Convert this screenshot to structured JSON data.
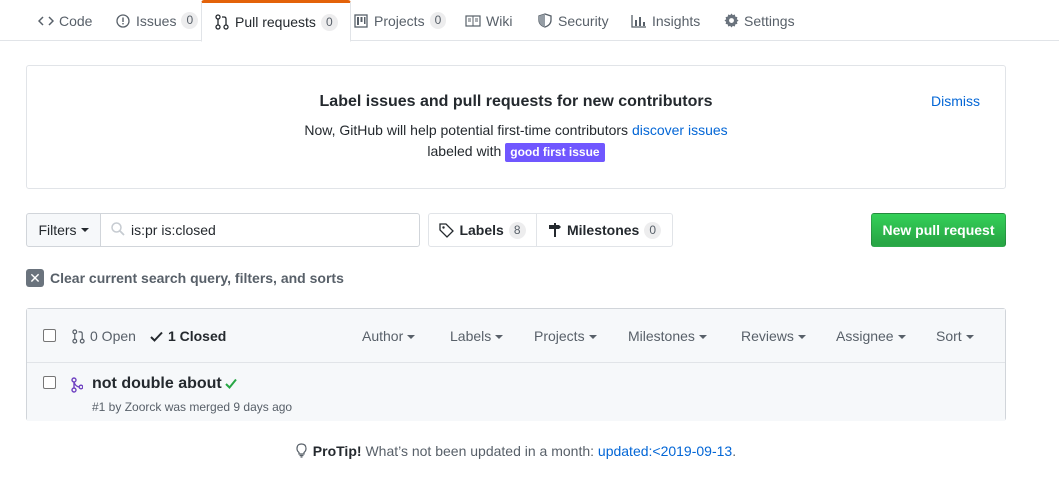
{
  "tabs": {
    "code": {
      "label": "Code"
    },
    "issues": {
      "label": "Issues",
      "count": "0"
    },
    "pulls": {
      "label": "Pull requests",
      "count": "0"
    },
    "projects": {
      "label": "Projects",
      "count": "0"
    },
    "wiki": {
      "label": "Wiki"
    },
    "security": {
      "label": "Security"
    },
    "insights": {
      "label": "Insights"
    },
    "settings": {
      "label": "Settings"
    }
  },
  "banner": {
    "title": "Label issues and pull requests for new contributors",
    "line1_text": "Now, GitHub will help potential first-time contributors",
    "line1_link": "discover issues",
    "line2_text": "labeled with",
    "label_name": "good first issue",
    "label_color": "#7057ff",
    "dismiss": "Dismiss"
  },
  "filters": {
    "button": "Filters",
    "search_value": "is:pr is:closed",
    "labels_label": "Labels",
    "labels_count": "8",
    "milestones_label": "Milestones",
    "milestones_count": "0",
    "new_pr": "New pull request"
  },
  "clear": {
    "label": "Clear current search query, filters, and sorts"
  },
  "list": {
    "open_label": "0 Open",
    "closed_label": "1 Closed",
    "selects": {
      "author": "Author",
      "labels": "Labels",
      "projects": "Projects",
      "milestones": "Milestones",
      "reviews": "Reviews",
      "assignee": "Assignee",
      "sort": "Sort"
    },
    "items": [
      {
        "title": "not double about",
        "meta": "#1 by Zoorck was merged 9 days ago",
        "status_icon": "check-icon"
      }
    ]
  },
  "protip": {
    "bold": "ProTip!",
    "text": "What’s not been updated in a month:",
    "link": "updated:<2019-09-13",
    "suffix": "."
  },
  "colors": {
    "accent_tab": "#e36209",
    "primary_button": "#2cbe4e",
    "link": "#0366d6",
    "merged": "#6f42c1"
  }
}
